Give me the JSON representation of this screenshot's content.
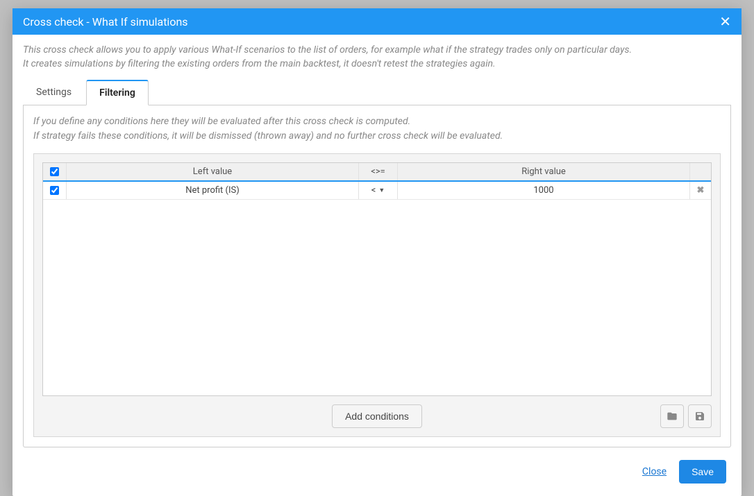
{
  "header": {
    "title": "Cross check - What If simulations"
  },
  "description": {
    "line1": "This cross check allows you to apply various What-If scenarios to the list of orders, for example what if the strategy trades only on particular days.",
    "line2": "It creates simulations by filtering the existing orders from the main backtest, it doesn't retest the strategies again."
  },
  "tabs": {
    "settings": "Settings",
    "filtering": "Filtering"
  },
  "filtering_desc": {
    "line1": "If you define any conditions here they will be evaluated after this cross check is computed.",
    "line2": "If strategy fails these conditions, it will be dismissed (thrown away) and no further cross check will be evaluated."
  },
  "grid": {
    "headers": {
      "left": "Left value",
      "op": "<>=",
      "right": "Right value"
    },
    "rows": [
      {
        "checked": true,
        "left": "Net profit (IS)",
        "op": "<",
        "right": "1000"
      }
    ]
  },
  "buttons": {
    "add": "Add conditions",
    "close": "Close",
    "save": "Save"
  }
}
